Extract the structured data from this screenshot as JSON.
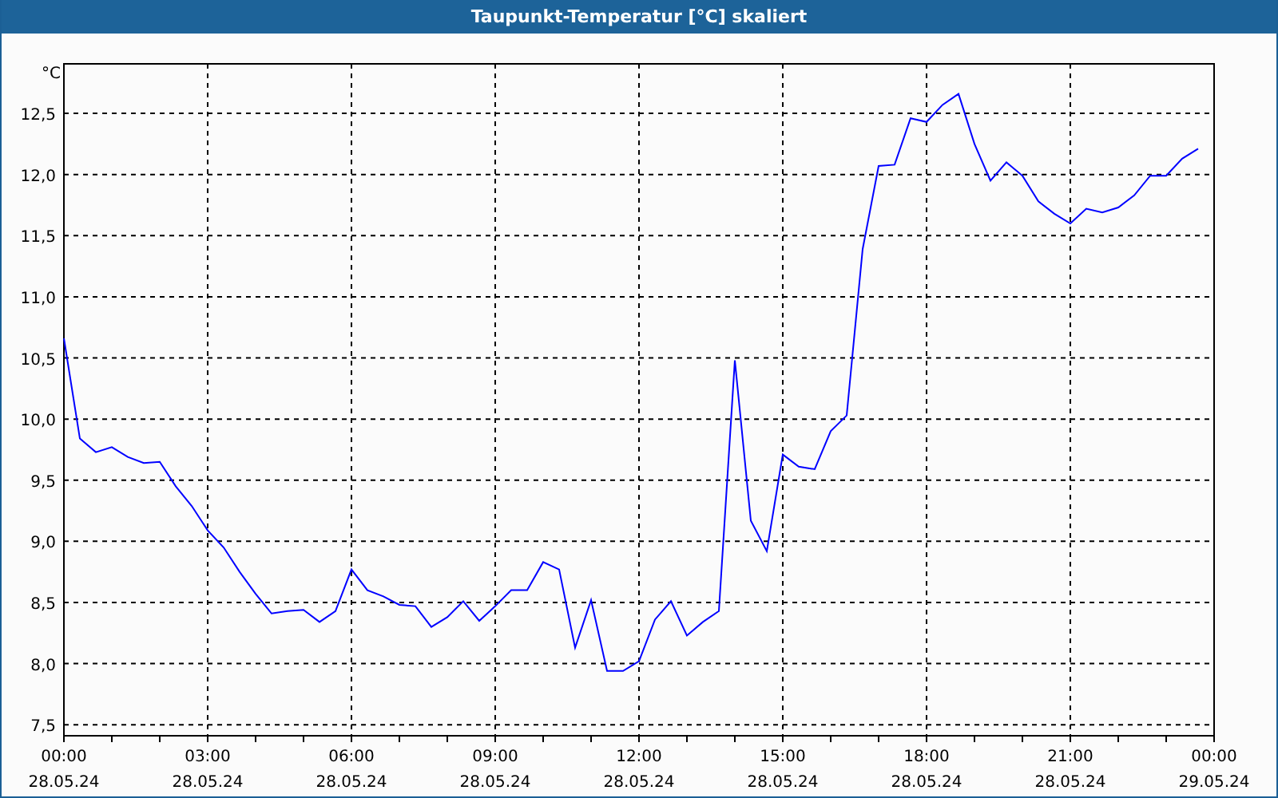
{
  "window": {
    "title": "Taupunkt-Temperatur [°C] skaliert"
  },
  "chart": {
    "chart_data": {
      "type": "line",
      "grid": true,
      "ylabel": "°C",
      "ylim": [
        7.41,
        12.905
      ],
      "yticks": [
        {
          "value": 7.5,
          "label": "7,5"
        },
        {
          "value": 8,
          "label": "8,0"
        },
        {
          "value": 8.5,
          "label": "8,5"
        },
        {
          "value": 9,
          "label": "9,0"
        },
        {
          "value": 9.5,
          "label": "9,5"
        },
        {
          "value": 10,
          "label": "10,0"
        },
        {
          "value": 10.5,
          "label": "10,5"
        },
        {
          "value": 11,
          "label": "11,0"
        },
        {
          "value": 11.5,
          "label": "11,5"
        },
        {
          "value": 12,
          "label": "12,0"
        },
        {
          "value": 12.5,
          "label": "12,5"
        }
      ],
      "categories": [
        "00:00\n28.05.24",
        null,
        null,
        null,
        null,
        null,
        null,
        null,
        null,
        "03:00\n28.05.24",
        null,
        null,
        null,
        null,
        null,
        null,
        null,
        null,
        "06:00\n28.05.24",
        null,
        null,
        null,
        null,
        null,
        null,
        null,
        null,
        "09:00\n28.05.24",
        null,
        null,
        null,
        null,
        null,
        null,
        null,
        null,
        "12:00\n28.05.24",
        null,
        null,
        null,
        null,
        null,
        null,
        null,
        null,
        "15:00\n28.05.24",
        null,
        null,
        null,
        null,
        null,
        null,
        null,
        null,
        "18:00\n28.05.24",
        null,
        null,
        null,
        null,
        null,
        null,
        null,
        null,
        "21:00\n28.05.24",
        null,
        null,
        null,
        null,
        null,
        null,
        null,
        null,
        "00:00\n29.05.24"
      ],
      "series": [
        {
          "color": "#0000ff",
          "values": [
            10.66,
            9.84,
            9.73,
            9.77,
            9.69,
            9.64,
            9.65,
            9.45,
            9.29,
            9.09,
            8.95,
            8.75,
            8.57,
            8.41,
            8.43,
            8.44,
            8.34,
            8.43,
            8.77,
            8.6,
            8.55,
            8.48,
            8.47,
            8.3,
            8.38,
            8.51,
            8.35,
            8.47,
            8.6,
            8.6,
            8.83,
            8.77,
            8.13,
            8.52,
            7.94,
            7.94,
            8.02,
            8.36,
            8.51,
            8.23,
            8.34,
            8.43,
            10.48,
            9.17,
            8.92,
            9.71,
            9.61,
            9.59,
            9.9,
            10.03,
            11.39,
            12.07,
            12.08,
            12.46,
            12.43,
            12.57,
            12.66,
            12.25,
            11.95,
            12.1,
            11.99,
            11.78,
            11.68,
            11.6,
            11.72,
            11.69,
            11.73,
            11.83,
            11.99,
            11.99,
            12.13,
            12.21,
            null
          ]
        }
      ]
    }
  }
}
